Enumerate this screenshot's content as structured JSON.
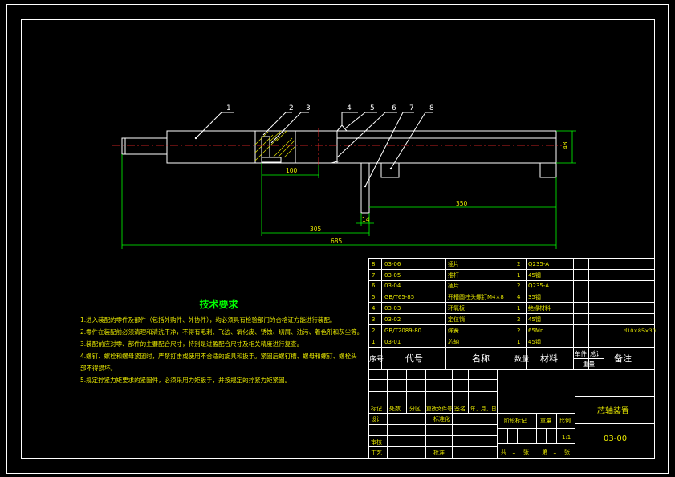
{
  "drawing": {
    "part_labels": [
      "1",
      "2",
      "3",
      "4",
      "5",
      "6",
      "7",
      "8"
    ],
    "dimensions": {
      "d100": "100",
      "d305": "305",
      "d14": "14",
      "d350": "350",
      "d685": "685",
      "d48": "48"
    }
  },
  "notes": {
    "title": "技术要求",
    "lines": [
      "1.进入装配的零件及部件（包括外购件、外协件），均必须具有检验部门的合格证方能进行装配。",
      "2.零件在装配前必须清理和清洗干净，不得有毛刺、飞边、氧化皮、锈蚀、切屑、油污、着色剂和灰尘等。",
      "3.装配前应对零、部件的主要配合尺寸，特别是过盈配合尺寸及相关精度进行复查。",
      "4.螺钉、螺栓和螺母紧固时，严禁打击或使用不合适的旋具和扳手。紧固后螺钉槽、螺母和螺钉、螺栓头部不得损坏。",
      "5.规定拧紧力矩要求的紧固件，必须采用力矩扳手，并按规定的拧紧力矩紧固。"
    ]
  },
  "bom": {
    "rows": [
      {
        "no": "8",
        "code": "03-06",
        "name": "插片",
        "qty": "2",
        "material": "Q235-A",
        "note": ""
      },
      {
        "no": "7",
        "code": "03-05",
        "name": "推杆",
        "qty": "1",
        "material": "45钢",
        "note": ""
      },
      {
        "no": "6",
        "code": "03-04",
        "name": "插片",
        "qty": "2",
        "material": "Q235-A",
        "note": ""
      },
      {
        "no": "5",
        "code": "GB/T65-85",
        "name": "开槽圆柱头螺钉M4×8",
        "qty": "4",
        "material": "35钢",
        "note": ""
      },
      {
        "no": "4",
        "code": "03-03",
        "name": "环氧板",
        "qty": "1",
        "material": "绝缘材料",
        "note": ""
      },
      {
        "no": "3",
        "code": "03-02",
        "name": "定位销",
        "qty": "2",
        "material": "45钢",
        "note": ""
      },
      {
        "no": "2",
        "code": "GB/T2089-80",
        "name": "弹簧",
        "qty": "2",
        "material": "65Mn",
        "note": "d10×85×30"
      },
      {
        "no": "1",
        "code": "03-01",
        "name": "芯轴",
        "qty": "1",
        "material": "45钢",
        "note": ""
      }
    ],
    "header": {
      "no": "序号",
      "code": "代号",
      "name": "名称",
      "qty": "数量",
      "material": "材料",
      "single": "单件",
      "total": "总计",
      "weight": "重量",
      "note": "备注"
    }
  },
  "title_block": {
    "title": "芯轴装置",
    "drawing_no": "03-00",
    "scale": "1:1",
    "labels": {
      "mark": "标记",
      "count": "处数",
      "zone": "分区",
      "change_doc": "更改文件号",
      "sign": "签名",
      "date": "年、月、日",
      "design": "设计",
      "standardize": "标准化",
      "stage": "阶段标记",
      "weight": "重量",
      "scale": "比例",
      "review": "审核",
      "process": "工艺",
      "approve": "批准",
      "total_sheets": "共",
      "sheets_unit": "张",
      "sheet": "第",
      "sheet_unit2": "张",
      "total_value": "1",
      "sheet_value": "1"
    }
  }
}
